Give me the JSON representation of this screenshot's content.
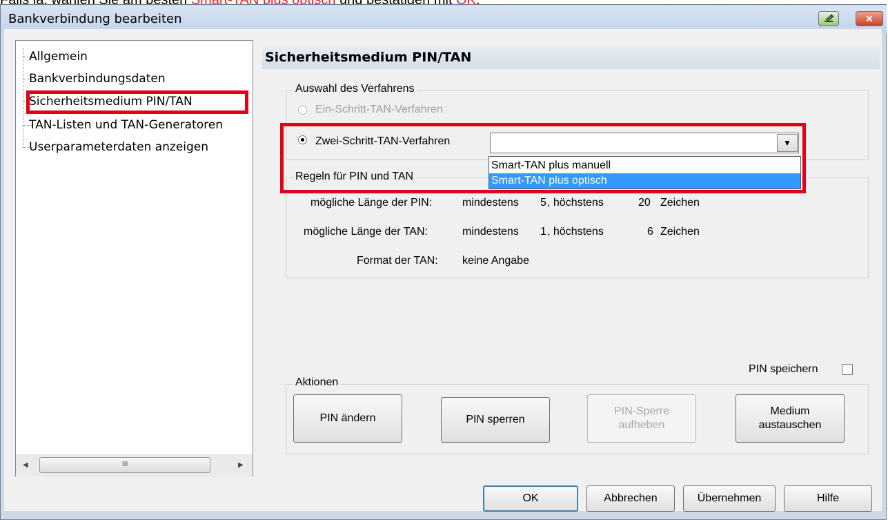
{
  "caption": {
    "prefix": "Falls ja, wählen Sie am besten ",
    "highlight1": "Smart-TAN plus optisch",
    "middle": " und bestätigen mit ",
    "highlight2": "OK",
    "suffix": "."
  },
  "window": {
    "title": "Bankverbindung bearbeiten",
    "close_symbol": "✕"
  },
  "tree": {
    "items": [
      "Allgemein",
      "Bankverbindungsdaten",
      "Sicherheitsmedium PIN/TAN",
      "TAN-Listen und TAN-Generatoren",
      "Userparameterdaten anzeigen"
    ],
    "scroll_thumb": "III"
  },
  "section": {
    "title": "Sicherheitsmedium PIN/TAN"
  },
  "verfahren": {
    "group_label": "Auswahl des Verfahrens",
    "option1": "Ein-Schritt-TAN-Verfahren",
    "option2": "Zwei-Schritt-TAN-Verfahren",
    "combo_value": "",
    "dropdown_options": [
      "Smart-TAN plus manuell",
      "Smart-TAN plus optisch"
    ]
  },
  "regeln": {
    "group_label": "Regeln für PIN und TAN",
    "pin_label": "mögliche Länge der PIN:",
    "pin_min_label": "mindestens",
    "pin_min": "5",
    "pin_max_label": ", höchstens",
    "pin_max": "20",
    "pin_unit": "Zeichen",
    "tan_label": "mögliche Länge der TAN:",
    "tan_min_label": "mindestens",
    "tan_min": "1",
    "tan_max_label": ", höchstens",
    "tan_max": "6",
    "tan_unit": "Zeichen",
    "format_label": "Format der TAN:",
    "format_value": "keine Angabe"
  },
  "pin_speichern": "PIN speichern",
  "aktionen": {
    "group_label": "Aktionen",
    "buttons": [
      "PIN ändern",
      "PIN sperren",
      "PIN-Sperre\naufheben",
      "Medium\naustauschen"
    ]
  },
  "footer": {
    "ok": "OK",
    "cancel": "Abbrechen",
    "apply": "Übernehmen",
    "help": "Hilfe"
  },
  "colors": {
    "highlight_red": "#e3001b",
    "selection_blue": "#3399ff"
  }
}
